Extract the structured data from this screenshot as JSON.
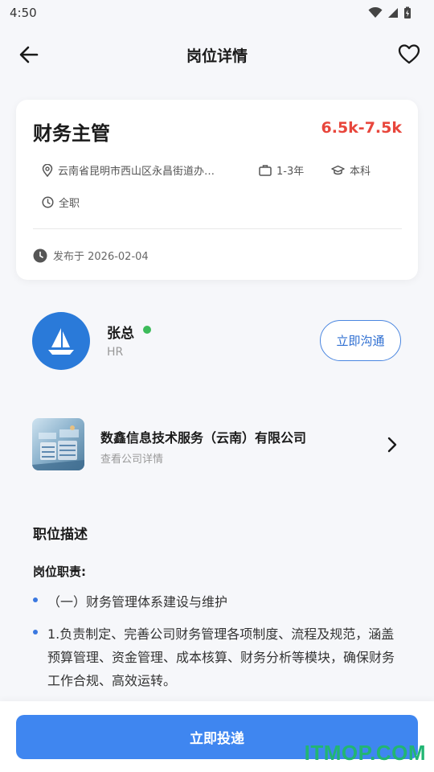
{
  "status_bar": {
    "time": "4:50"
  },
  "header": {
    "title": "岗位详情"
  },
  "job": {
    "title": "财务主管",
    "salary": "6.5k-7.5k",
    "location": "云南省昆明市西山区永昌街道办…",
    "experience": "1-3年",
    "education": "本科",
    "job_type": "全职",
    "publish": "发布于 2026-02-04"
  },
  "recruiter": {
    "name": "张总",
    "role": "HR",
    "chat_label": "立即沟通",
    "status_color": "#3dbb5a"
  },
  "company": {
    "name": "数鑫信息技术服务（云南）有限公司",
    "sub": "查看公司详情"
  },
  "description": {
    "title": "职位描述",
    "subtitle": "岗位职责:",
    "items": [
      "（一）财务管理体系建设与维护",
      "1.负责制定、完善公司财务管理各项制度、流程及规范，涵盖预算管理、资金管理、成本核算、财务分析等模块，确保财务工作合规、高效运转。"
    ]
  },
  "footer": {
    "apply_label": "立即投递"
  },
  "watermark": "ITMOP.COM",
  "colors": {
    "accent": "#3f86f0",
    "salary": "#e8463c",
    "watermark": "#22b573"
  }
}
